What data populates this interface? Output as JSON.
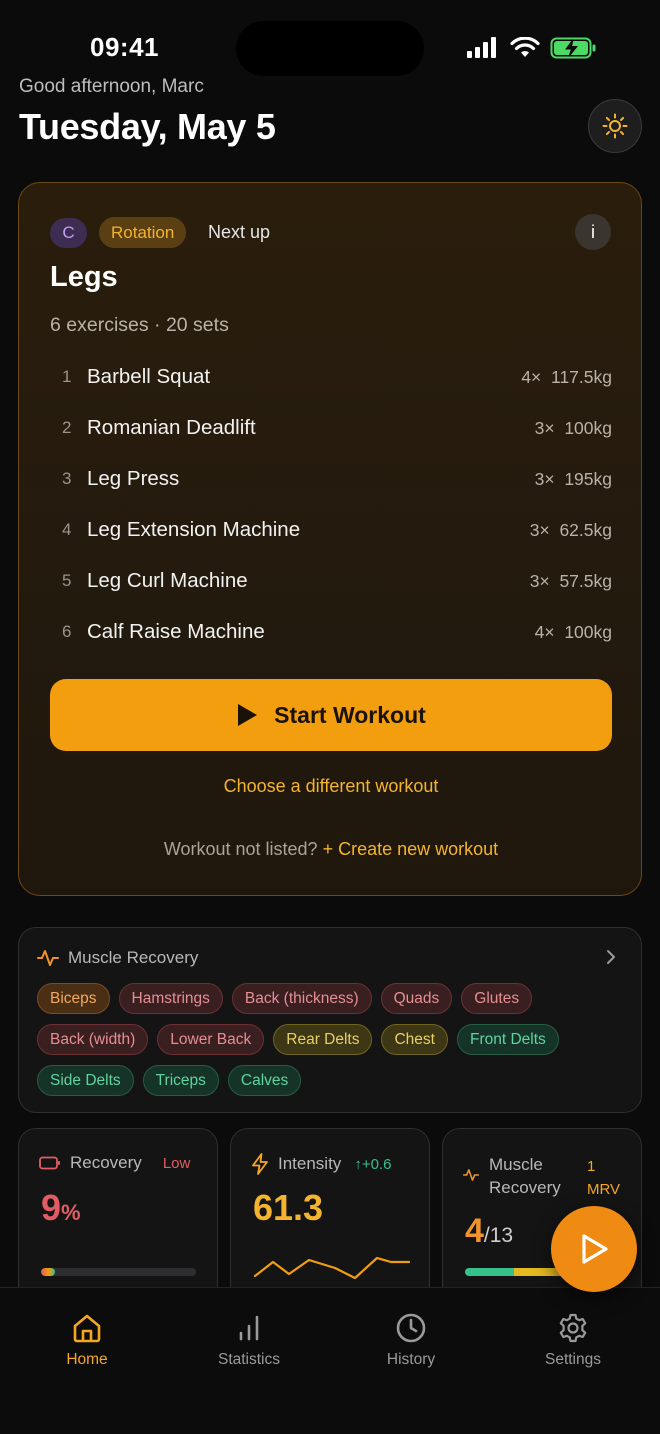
{
  "status_bar": {
    "time": "09:41"
  },
  "header": {
    "greeting": "Good afternoon, Marc",
    "date": "Tuesday, May 5"
  },
  "workout": {
    "rotation_letter": "C",
    "rotation_label": "Rotation",
    "next_up": "Next up",
    "info_label": "i",
    "name": "Legs",
    "meta": "6 exercises · 20 sets",
    "exercises": [
      {
        "num": "1",
        "name": "Barbell Squat",
        "sets": "4×",
        "weight": "117.5kg"
      },
      {
        "num": "2",
        "name": "Romanian Deadlift",
        "sets": "3×",
        "weight": "100kg"
      },
      {
        "num": "3",
        "name": "Leg Press",
        "sets": "3×",
        "weight": "195kg"
      },
      {
        "num": "4",
        "name": "Leg Extension Machine",
        "sets": "3×",
        "weight": "62.5kg"
      },
      {
        "num": "5",
        "name": "Leg Curl Machine",
        "sets": "3×",
        "weight": "57.5kg"
      },
      {
        "num": "6",
        "name": "Calf Raise Machine",
        "sets": "4×",
        "weight": "100kg"
      }
    ],
    "start_label": "Start Workout",
    "choose_label": "Choose a different workout",
    "not_listed": "Workout not listed?",
    "create_label": "+ Create new workout"
  },
  "muscle_recovery": {
    "title": "Muscle Recovery",
    "tags": [
      {
        "label": "Biceps",
        "status": "orange"
      },
      {
        "label": "Hamstrings",
        "status": "red"
      },
      {
        "label": "Back (thickness)",
        "status": "red"
      },
      {
        "label": "Quads",
        "status": "red"
      },
      {
        "label": "Glutes",
        "status": "red"
      },
      {
        "label": "Back (width)",
        "status": "red"
      },
      {
        "label": "Lower Back",
        "status": "red"
      },
      {
        "label": "Rear Delts",
        "status": "yellow"
      },
      {
        "label": "Chest",
        "status": "yellow"
      },
      {
        "label": "Front Delts",
        "status": "green"
      },
      {
        "label": "Side Delts",
        "status": "green"
      },
      {
        "label": "Triceps",
        "status": "green"
      },
      {
        "label": "Calves",
        "status": "green"
      }
    ]
  },
  "stats": {
    "recovery": {
      "label": "Recovery",
      "status": "Low",
      "value": "9",
      "unit": "%",
      "level": 0.09
    },
    "intensity": {
      "label": "Intensity",
      "delta": "↑+0.6",
      "value": "61.3"
    },
    "muscle": {
      "label_line1": "Muscle",
      "label_line2": "Recovery",
      "badge_line1": "1",
      "badge_line2": "MRV",
      "value": "4",
      "total": "/13",
      "recovered": 4,
      "count": 13
    }
  },
  "nav": {
    "home": "Home",
    "statistics": "Statistics",
    "history": "History",
    "settings": "Settings"
  },
  "colors": {
    "accent": "#f29e0f",
    "danger": "#e25d63",
    "success": "#36c08a"
  }
}
